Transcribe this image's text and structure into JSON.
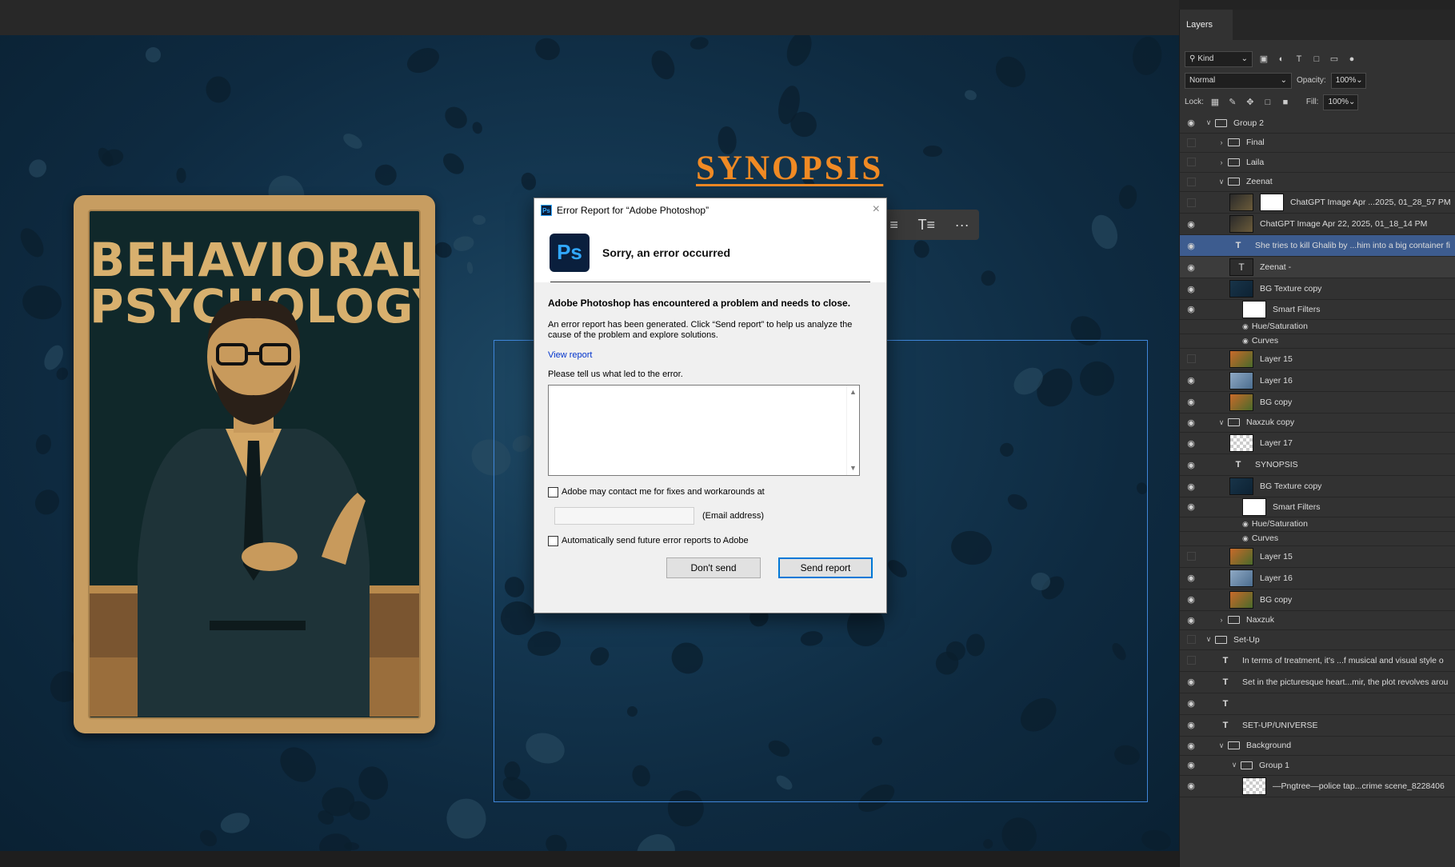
{
  "canvas": {
    "synopsis_title": "SYNOPSIS",
    "poster_title_line1": "BEHAVIORAL",
    "poster_title_line2": "PSYCHOLOGY"
  },
  "context_bar": {
    "align_icon": "align-icon",
    "text_icon": "text-settings-icon",
    "more_icon": "more-icon",
    "more_label": "···"
  },
  "dialog": {
    "title": "Error Report for “Adobe Photoshop”",
    "close": "×",
    "logo": "Ps",
    "heading": "Sorry, an error occurred",
    "problem": "Adobe Photoshop has encountered a problem and needs to close.",
    "description": "An error report has been generated. Click “Send report” to help us analyze the cause of the problem and explore solutions.",
    "view_report": "View report",
    "tell_us": "Please tell us what led to the error.",
    "textarea_value": "",
    "contact_label": "Adobe may contact me for fixes and workarounds at",
    "email_value": "",
    "email_label": "(Email address)",
    "auto_send_label": "Automatically send future error reports to Adobe",
    "dont_send": "Don't send",
    "send_report": "Send report"
  },
  "layers_panel": {
    "tab": "Layers",
    "filter_kind": "Kind",
    "blend_mode": "Normal",
    "opacity_label": "Opacity:",
    "opacity_value": "100%",
    "lock_label": "Lock:",
    "fill_label": "Fill:",
    "fill_value": "100%",
    "layers": [
      {
        "name": "Group 2",
        "kind": "group",
        "indent": 0,
        "expanded": true,
        "visible": true
      },
      {
        "name": "Final",
        "kind": "group",
        "indent": 1,
        "expanded": false,
        "visible": false
      },
      {
        "name": "Laila",
        "kind": "group",
        "indent": 1,
        "expanded": false,
        "visible": false
      },
      {
        "name": "Zeenat",
        "kind": "group",
        "indent": 1,
        "expanded": true,
        "visible": false
      },
      {
        "name": "ChatGPT Image Apr ...2025, 01_28_57 PM",
        "kind": "image-mask",
        "indent": 2,
        "visible": false
      },
      {
        "name": "ChatGPT Image Apr 22, 2025, 01_18_14 PM",
        "kind": "image",
        "indent": 2,
        "visible": true
      },
      {
        "name": "She tries to kill Ghalib by ...him into a big container fi",
        "kind": "text",
        "indent": 2,
        "visible": true,
        "selected": true
      },
      {
        "name": "Zeenat -",
        "kind": "text-thumb",
        "indent": 2,
        "visible": true,
        "highlight": true
      },
      {
        "name": "BG Texture copy",
        "kind": "smart",
        "indent": 2,
        "visible": true
      },
      {
        "name": "Smart Filters",
        "kind": "filters",
        "indent": 3,
        "visible": true
      },
      {
        "name": "Hue/Saturation",
        "kind": "filter",
        "indent": 3,
        "visible": true
      },
      {
        "name": "Curves",
        "kind": "filter",
        "indent": 3,
        "visible": true
      },
      {
        "name": "Layer 15",
        "kind": "fire",
        "indent": 2,
        "visible": false
      },
      {
        "name": "Layer 16",
        "kind": "snow",
        "indent": 2,
        "visible": true
      },
      {
        "name": "BG copy",
        "kind": "fire",
        "indent": 2,
        "visible": true
      },
      {
        "name": "Naxzuk copy",
        "kind": "group",
        "indent": 1,
        "expanded": true,
        "visible": true
      },
      {
        "name": "Layer 17",
        "kind": "check",
        "indent": 2,
        "visible": true
      },
      {
        "name": "SYNOPSIS",
        "kind": "text",
        "indent": 2,
        "visible": true
      },
      {
        "name": "BG Texture copy",
        "kind": "smart",
        "indent": 2,
        "visible": true
      },
      {
        "name": "Smart Filters",
        "kind": "filters",
        "indent": 3,
        "visible": true
      },
      {
        "name": "Hue/Saturation",
        "kind": "filter",
        "indent": 3,
        "visible": true
      },
      {
        "name": "Curves",
        "kind": "filter",
        "indent": 3,
        "visible": true
      },
      {
        "name": "Layer 15",
        "kind": "fire",
        "indent": 2,
        "visible": false
      },
      {
        "name": "Layer 16",
        "kind": "snow",
        "indent": 2,
        "visible": true
      },
      {
        "name": "BG copy",
        "kind": "fire",
        "indent": 2,
        "visible": true
      },
      {
        "name": "Naxzuk",
        "kind": "group",
        "indent": 1,
        "expanded": false,
        "visible": true
      },
      {
        "name": "Set-Up",
        "kind": "group",
        "indent": 0,
        "expanded": true,
        "visible": false
      },
      {
        "name": "In terms of treatment, it's ...f musical and visual style o",
        "kind": "text",
        "indent": 1,
        "visible": false
      },
      {
        "name": "Set in the picturesque heart...mir, the plot revolves arou",
        "kind": "text",
        "indent": 1,
        "visible": true
      },
      {
        "name": "",
        "kind": "text",
        "indent": 1,
        "visible": true
      },
      {
        "name": "SET-UP/UNIVERSE",
        "kind": "text",
        "indent": 1,
        "visible": true
      },
      {
        "name": "Background",
        "kind": "group",
        "indent": 1,
        "expanded": true,
        "visible": true
      },
      {
        "name": "Group 1",
        "kind": "group",
        "indent": 2,
        "expanded": true,
        "visible": true
      },
      {
        "name": "—Pngtree—police tap...crime scene_8228406",
        "kind": "check",
        "indent": 3,
        "visible": true
      }
    ]
  }
}
